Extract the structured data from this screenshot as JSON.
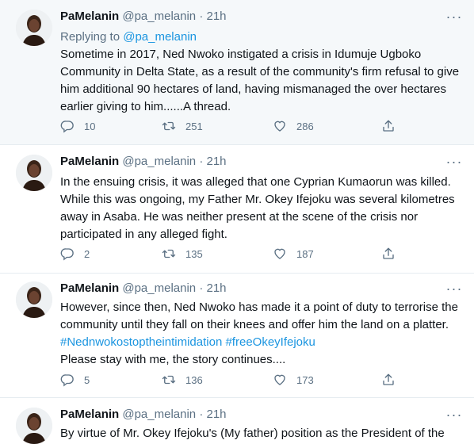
{
  "tweets": [
    {
      "name": "PaMelanin",
      "handle": "@pa_melanin",
      "dot": "·",
      "time": "21h",
      "replying_prefix": "Replying to",
      "replying_to": "@pa_melanin",
      "text": "Sometime in 2017, Ned Nwoko instigated a crisis in Idumuje Ugboko Community in Delta State, as a result of the community's firm refusal to give him additional 90 hectares of land, having mismanaged the over hectares earlier giving to him......A thread.",
      "replies": "10",
      "retweets": "251",
      "likes": "286"
    },
    {
      "name": "PaMelanin",
      "handle": "@pa_melanin",
      "dot": "·",
      "time": "21h",
      "text": "In the ensuing crisis, it was alleged that one Cyprian Kumaorun was killed. While this was ongoing, my Father Mr. Okey Ifejoku was several kilometres away in Asaba. He was neither present at the scene of the crisis nor participated in any alleged fight.",
      "replies": "2",
      "retweets": "135",
      "likes": "187"
    },
    {
      "name": "PaMelanin",
      "handle": "@pa_melanin",
      "dot": "·",
      "time": "21h",
      "text": "However, since then, Ned Nwoko has made it a point of duty to terrorise the community until they fall on their knees and offer him the land on a platter.",
      "hashtag1": "#Nednwokostoptheintimidation",
      "hashtag2": "#freeOkeyIfejoku",
      "text2": "Please stay with me, the story continues....",
      "replies": "5",
      "retweets": "136",
      "likes": "173"
    },
    {
      "name": "PaMelanin",
      "handle": "@pa_melanin",
      "dot": "·",
      "time": "21h",
      "text": "By virtue of Mr. Okey Ifejoku's (My father) position as the President of the"
    }
  ],
  "icons": {
    "more": "more-icon",
    "reply": "reply-icon",
    "retweet": "retweet-icon",
    "like": "like-icon",
    "share": "share-icon"
  },
  "colors": {
    "link": "#1b95e0",
    "secondary": "#5b7083",
    "highlight_bg": "#f5f8fa"
  }
}
